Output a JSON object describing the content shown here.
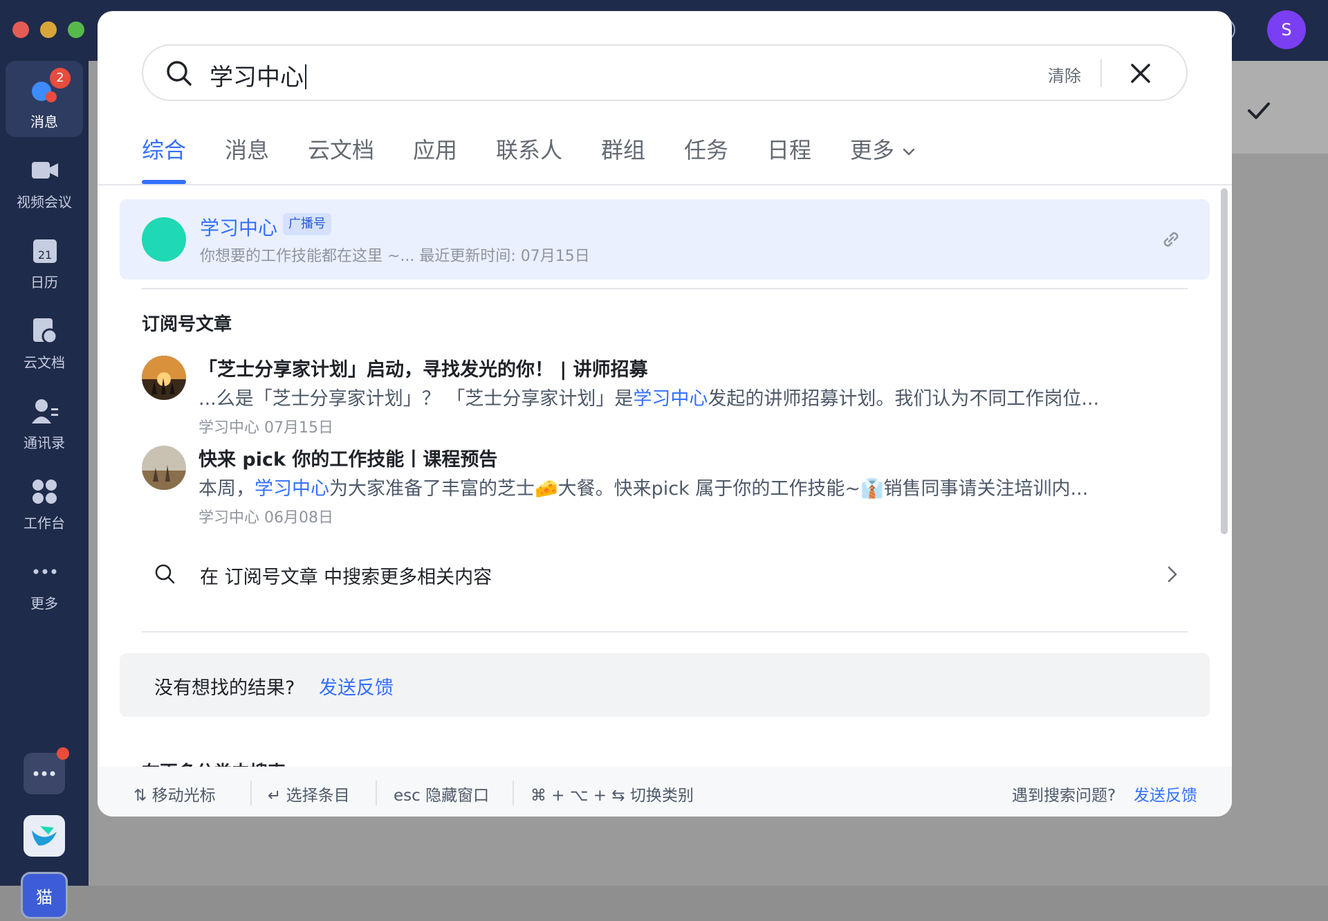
{
  "sidebar": {
    "items": [
      {
        "label": "消息",
        "badge": "2",
        "icon": "message-icon"
      },
      {
        "label": "视频会议",
        "icon": "video-icon"
      },
      {
        "label": "日历",
        "icon": "calendar-icon",
        "icon_text": "21"
      },
      {
        "label": "云文档",
        "icon": "docs-icon"
      },
      {
        "label": "通讯录",
        "icon": "contacts-icon"
      },
      {
        "label": "工作台",
        "icon": "workspace-icon"
      },
      {
        "label": "更多",
        "icon": "more-icon"
      }
    ],
    "bottom_app_label": "猫"
  },
  "titlebar": {
    "avatar_letter": "S"
  },
  "search": {
    "query": "学习中心",
    "clear_label": "清除"
  },
  "tabs": [
    {
      "label": "综合",
      "active": true
    },
    {
      "label": "消息"
    },
    {
      "label": "云文档"
    },
    {
      "label": "应用"
    },
    {
      "label": "联系人"
    },
    {
      "label": "群组"
    },
    {
      "label": "任务"
    },
    {
      "label": "日程"
    },
    {
      "label": "更多"
    }
  ],
  "top_hit": {
    "name": "学习中心",
    "tag": "广播号",
    "description": "你想要的工作技能都在这里 ~... 最近更新时间: 07月15日"
  },
  "section": {
    "title": "订阅号文章",
    "articles": [
      {
        "title": "「芝士分享家计划」启动，寻找发光的你！ | 讲师招募",
        "snippet_before": "...么是「芝士分享家计划」？ 「芝士分享家计划」是",
        "snippet_highlight": "学习中心",
        "snippet_after": "发起的讲师招募计划。我们认为不同工作岗位...",
        "meta": "学习中心 07月15日"
      },
      {
        "title": "快来 pick 你的工作技能丨课程预告",
        "snippet_before": "本周，",
        "snippet_highlight": "学习中心",
        "snippet_after": "为大家准备了丰富的芝士🧀大餐。快来pick 属于你的工作技能~👔销售同事请关注培训内...",
        "meta": "学习中心 06月08日"
      }
    ],
    "more_text": "在 订阅号文章 中搜索更多相关内容"
  },
  "feedback": {
    "question": "没有想找的结果?",
    "action": "发送反馈"
  },
  "cut_off_heading": "在更多分类中搜索",
  "footer": {
    "hints": [
      {
        "key": "⇅",
        "label": "移动光标"
      },
      {
        "key": "↵",
        "label": "选择条目"
      },
      {
        "key": "esc",
        "label": "隐藏窗口"
      },
      {
        "key": "⌘ + ⌥ + ⇆",
        "label": "切换类别"
      }
    ],
    "question": "遇到搜索问题?",
    "action": "发送反馈"
  },
  "colors": {
    "accent": "#3370ff",
    "sidebar": "#1f2b4a",
    "highlight_bg": "#eaf0fe"
  }
}
